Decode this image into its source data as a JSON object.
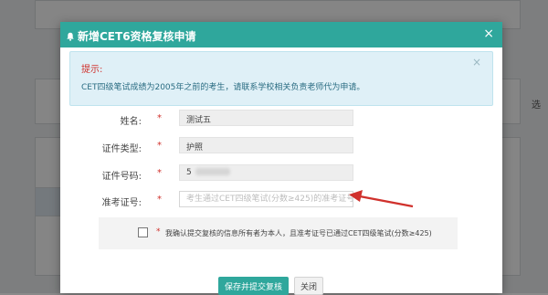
{
  "modal": {
    "title": "新增CET6资格复核申请",
    "close_glyph": "×"
  },
  "alert": {
    "title": "提示:",
    "body": "CET四级笔试成绩为2005年之前的考生，请联系学校相关负责老师代为申请。",
    "close_glyph": "×"
  },
  "form": {
    "required_mark": "*",
    "name": {
      "label": "姓名:",
      "value": "测试五"
    },
    "id_type": {
      "label": "证件类型:",
      "value": "护照"
    },
    "id_number": {
      "label": "证件号码:",
      "value": "5"
    },
    "ticket_number": {
      "label": "准考证号:",
      "value": "",
      "placeholder": "考生通过CET四级笔试(分数≥425)的准考证号"
    }
  },
  "confirm": {
    "required_mark": "*",
    "text": "我确认提交复核的信息所有者为本人，且准考证号已通过CET四级笔试(分数≥425)",
    "checked": false
  },
  "buttons": {
    "submit": "保存并提交复核",
    "close": "关闭"
  },
  "background": {
    "side_text": "选"
  },
  "colors": {
    "accent": "#2fa79c",
    "required": "#d0312c",
    "alert_bg": "#dff0f7"
  },
  "icons": {
    "title_icon": "bell-icon",
    "annotation": "red-arrow-icon"
  }
}
